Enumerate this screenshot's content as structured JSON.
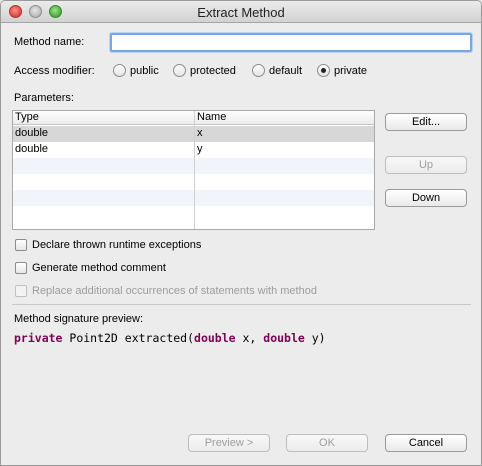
{
  "window": {
    "title": "Extract Method"
  },
  "method_name": {
    "label": "Method name:",
    "value": "",
    "placeholder": ""
  },
  "access_modifier": {
    "label": "Access modifier:",
    "options": [
      "public",
      "protected",
      "default",
      "private"
    ],
    "selected": "private"
  },
  "parameters": {
    "label": "Parameters:",
    "columns": [
      "Type",
      "Name"
    ],
    "rows": [
      {
        "type": "double",
        "name": "x"
      },
      {
        "type": "double",
        "name": "y"
      }
    ],
    "selected_row": 0
  },
  "buttons": {
    "edit": "Edit...",
    "up": "Up",
    "down": "Down",
    "preview": "Preview >",
    "ok": "OK",
    "cancel": "Cancel"
  },
  "options": {
    "declare_exceptions": "Declare thrown runtime exceptions",
    "generate_comment": "Generate method comment",
    "replace_occurrences": "Replace additional occurrences of statements with method"
  },
  "preview": {
    "label": "Method signature preview:",
    "tokens": [
      {
        "text": "private",
        "keyword": true
      },
      {
        "text": " Point2D extracted(",
        "keyword": false
      },
      {
        "text": "double",
        "keyword": true
      },
      {
        "text": " x, ",
        "keyword": false
      },
      {
        "text": "double",
        "keyword": true
      },
      {
        "text": " y)",
        "keyword": false
      }
    ]
  },
  "colors": {
    "keyword": "#7f0055",
    "focus_ring": "#7aa7e0",
    "selected_row": "#d7d7d7"
  }
}
